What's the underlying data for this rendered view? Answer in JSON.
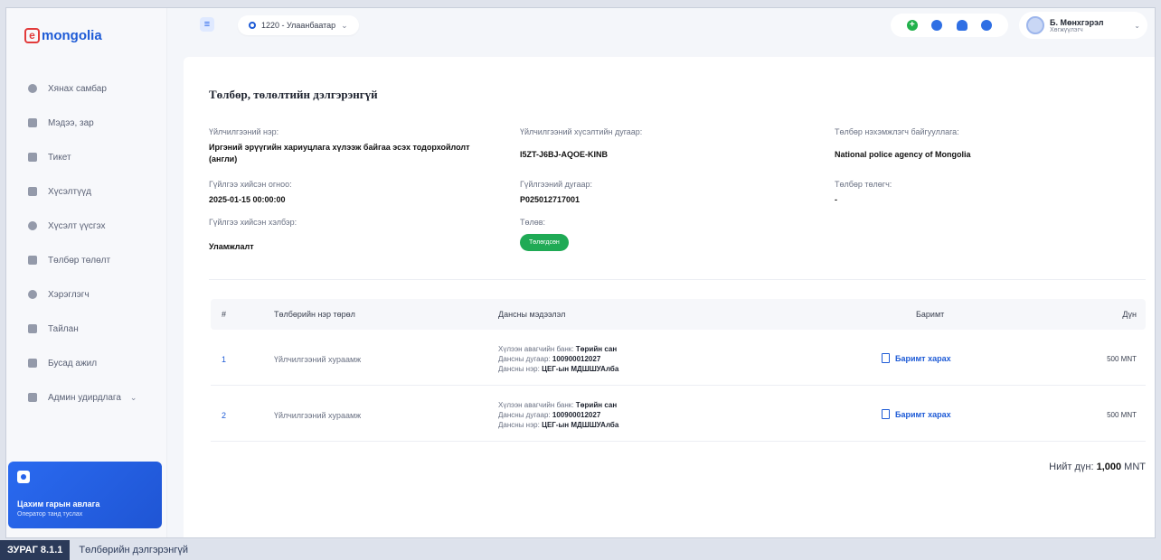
{
  "logo": {
    "letter": "e",
    "text": "mongolia"
  },
  "sidebar": {
    "items": [
      {
        "label": "Хянах самбар"
      },
      {
        "label": "Мэдээ, зар"
      },
      {
        "label": "Тикет"
      },
      {
        "label": "Хүсэлтүүд"
      },
      {
        "label": "Хүсэлт үүсгэх"
      },
      {
        "label": "Төлбөр төлөлт"
      },
      {
        "label": "Хэрэглэгч"
      },
      {
        "label": "Тайлан"
      },
      {
        "label": "Бусад ажил"
      },
      {
        "label": "Админ удирдлага"
      }
    ],
    "promo": {
      "title": "Цахим гарын авлага",
      "subtitle": "Оператор танд туслах"
    }
  },
  "topbar": {
    "location": "1220 - Улаанбаатар",
    "user": {
      "name": "Б. Мөнхгэрэл",
      "role": "Хөгжүүлэгч"
    }
  },
  "page": {
    "title": "Төлбөр, төлөлтийн дэлгэрэнгүй",
    "fields": {
      "service_name_label": "Үйлчилгээний нэр:",
      "service_name_value": "Иргэний эрүүгийн хариуцлага хүлээж байгаа эсэх тодорхойлолт (англи)",
      "request_no_label": "Үйлчилгээний хүсэлтийн дугаар:",
      "request_no_value": "I5ZT-J6BJ-AQOE-KINB",
      "billing_org_label": "Төлбөр нэхэмжлэгч байгууллага:",
      "billing_org_value": "National police agency of Mongolia",
      "tx_date_label": "Гүйлгээ хийсэн огноо:",
      "tx_date_value": "2025-01-15 00:00:00",
      "tx_no_label": "Гүйлгээний дугаар:",
      "tx_no_value": "P025012717001",
      "payer_label": "Төлбөр төлөгч:",
      "payer_value": "-",
      "tx_method_label": "Гүйлгээ хийсэн хэлбэр:",
      "tx_method_value": "Уламжлалт",
      "status_label": "Төлөв:",
      "status_value": "Төлөгдсөн"
    },
    "table": {
      "headers": {
        "num": "#",
        "type": "Төлбөрийн нэр төрөл",
        "account": "Дансны мэдээлэл",
        "receipt": "Баримт",
        "amount": "Дүн"
      },
      "rows": [
        {
          "num": "1",
          "type": "Үйлчилгээний хураамж",
          "bank_label": "Хүлээн авагчийн банк:",
          "bank": "Төрийн сан",
          "acct_label": "Дансны дугаар:",
          "acct": "100900012027",
          "acct_name_label": "Дансны нэр:",
          "acct_name": "ЦЕГ-ын МДШШУАлба",
          "receipt": "Баримт харах",
          "amount": "500 MNT"
        },
        {
          "num": "2",
          "type": "Үйлчилгээний хураамж",
          "bank_label": "Хүлээн авагчийн банк:",
          "bank": "Төрийн сан",
          "acct_label": "Дансны дугаар:",
          "acct": "100900012027",
          "acct_name_label": "Дансны нэр:",
          "acct_name": "ЦЕГ-ын МДШШУАлба",
          "receipt": "Баримт харах",
          "amount": "500 MNT"
        }
      ],
      "total_label": "Нийт дүн:",
      "total_value": "1,000",
      "total_currency": "MNT"
    }
  },
  "caption": {
    "label": "ЗУРАГ 8.1.1",
    "text": "Төлбөрийн дэлгэрэнгүй"
  },
  "colors": {
    "accent": "#1e5bd6",
    "status_paid": "#1faa55",
    "caption_dark": "#2b3a59"
  }
}
